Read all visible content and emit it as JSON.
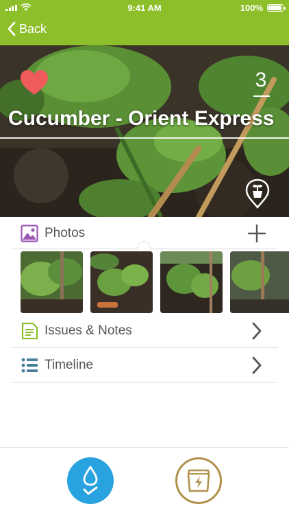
{
  "status_bar": {
    "time": "9:41 AM",
    "battery": "100%",
    "battery_level": 1.0
  },
  "nav": {
    "back_label": "Back"
  },
  "plant": {
    "name": "Cucumber - Orient Express",
    "count": "3",
    "favorite": true,
    "favorite_icon": "heart-icon",
    "location_icon": "plant-pin-icon"
  },
  "rows": {
    "photos": {
      "label": "Photos",
      "icon": "image-icon",
      "action_icon": "plus-icon"
    },
    "issues": {
      "label": "Issues & Notes",
      "icon": "note-icon",
      "action_icon": "chevron-right-icon"
    },
    "timeline": {
      "label": "Timeline",
      "icon": "list-icon",
      "action_icon": "chevron-right-icon"
    }
  },
  "photo_thumbnails": [
    "thumbnail-1",
    "thumbnail-2",
    "thumbnail-3",
    "thumbnail-4"
  ],
  "bottom_actions": [
    {
      "name": "water",
      "icon": "water-drop-check-icon"
    },
    {
      "name": "fertilize",
      "icon": "fertilizer-bag-icon"
    }
  ],
  "colors": {
    "header": "#8cbf2a",
    "heart": "#ef5b5b",
    "photos_icon": "#9b59b6",
    "issues_icon": "#8cbf2a",
    "timeline_icon": "#4a7f9a",
    "water": "#29a3df",
    "fertilize": "#b0904a",
    "text": "#555555"
  }
}
